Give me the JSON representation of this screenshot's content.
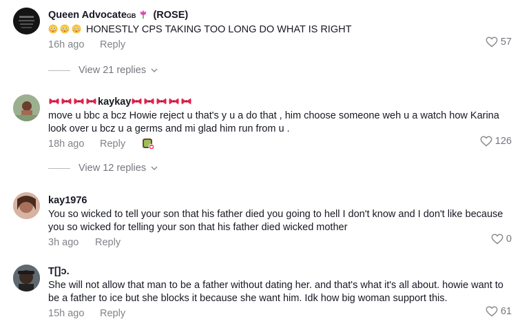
{
  "comments": [
    {
      "username": "Queen Advocate",
      "username_suffix_gb": "GB",
      "username_suffix_rose": "(ROSE)",
      "text": "HONESTLY CPS TAKING TOO LONG DO WHAT IS RIGHT",
      "time": "16h ago",
      "reply_label": "Reply",
      "likes": "57",
      "view_replies": "View 21 replies"
    },
    {
      "username": "kaykay",
      "text": "move u bbc a bcz Howie reject u that's y u a do that , him choose someone weh u a watch how Karina look over u bcz u a germs and mi glad him run from u .",
      "time": "18h ago",
      "reply_label": "Reply",
      "likes": "126",
      "view_replies": "View 12 replies"
    },
    {
      "username": "kay1976",
      "text": "You so wicked to tell your son that his father died you going to hell I don't know and I don't like because you so wicked for telling your son that his father died wicked mother",
      "time": "3h ago",
      "reply_label": "Reply",
      "likes": "0"
    },
    {
      "username": "T[]ɔ.",
      "text": "She will not allow that man to be a father without dating her. and that's what it's all about. howie want to be a father to ice but she blocks it because she want him. Idk how big woman support this.",
      "time": "15h ago",
      "reply_label": "Reply",
      "likes": "61"
    }
  ],
  "colors": {
    "text": "#161823",
    "muted": "#8a8b91",
    "bow": "#e0234e"
  },
  "icons": [
    "heart-icon",
    "chevron-down-icon",
    "flushed-face-emoji",
    "tulip-emoji",
    "bow-emoji"
  ]
}
